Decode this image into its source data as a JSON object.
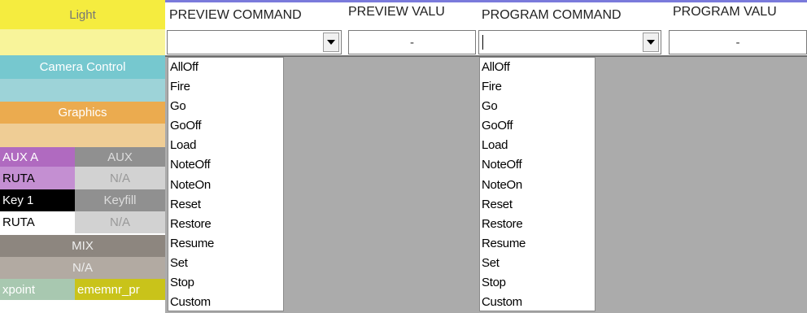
{
  "left_panel": {
    "light": {
      "label": "Light",
      "color": "#f5ec3f",
      "sub_color": "#f8f49a"
    },
    "camera_control": {
      "label": "Camera Control",
      "color": "#76c8cf",
      "sub_color": "#9dd3d8"
    },
    "graphics": {
      "label": "Graphics",
      "color": "#ebab4f",
      "sub_color": "#efcd95"
    },
    "aux_a": {
      "label": "AUX A",
      "value": "RUTA"
    },
    "aux": {
      "label": "AUX",
      "value": "N/A"
    },
    "key1": {
      "label": "Key 1",
      "value": "RUTA"
    },
    "keyfill": {
      "label": "Keyfill",
      "value": "N/A"
    },
    "mix": {
      "label": "MIX",
      "value": "N/A"
    },
    "xpoint": {
      "label": "xpoint"
    },
    "ememnr": {
      "label": "ememnr_pr"
    }
  },
  "headers": {
    "preview_command": "PREVIEW COMMAND",
    "preview_value": "PREVIEW VALU",
    "program_command": "PROGRAM COMMAND",
    "program_value": "PROGRAM VALU"
  },
  "preview_command_value": "",
  "program_command_value": "",
  "preview_value_text": "-",
  "program_value_text": "-",
  "commands": [
    "AllOff",
    "Fire",
    "Go",
    "GoOff",
    "Load",
    "NoteOff",
    "NoteOn",
    "Reset",
    "Restore",
    "Resume",
    "Set",
    "Stop",
    "Custom"
  ]
}
